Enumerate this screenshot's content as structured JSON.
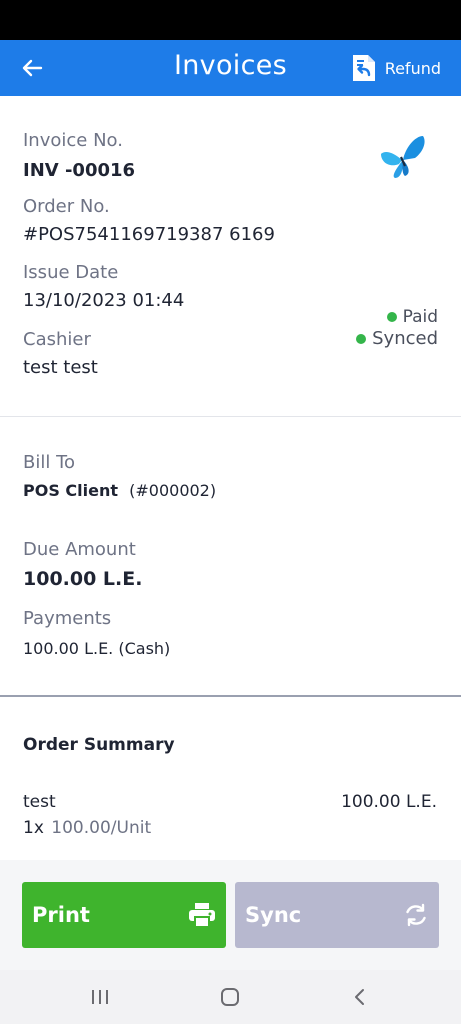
{
  "header": {
    "title": "Invoices",
    "refund_label": "Refund"
  },
  "invoice": {
    "invoice_no_label": "Invoice No.",
    "invoice_no": "INV -00016",
    "order_no_label": "Order No.",
    "order_no": "#POS7541169719387 6169",
    "issue_date_label": "Issue Date",
    "issue_date": "13/10/2023  01:44",
    "cashier_label": "Cashier",
    "cashier": "test test",
    "status_paid": "Paid",
    "status_synced": "Synced"
  },
  "billing": {
    "bill_to_label": "Bill To",
    "client_name": "POS Client",
    "client_id": "(#000002)",
    "due_amount_label": "Due Amount",
    "due_amount": "100.00 L.E.",
    "payments_label": "Payments",
    "payments_value": "100.00 L.E. (Cash)"
  },
  "summary": {
    "title": "Order Summary",
    "items": [
      {
        "name": "test",
        "qty": "1x",
        "unit_price": "100.00/Unit",
        "total": "100.00 L.E."
      }
    ]
  },
  "actions": {
    "print_label": "Print",
    "sync_label": "Sync"
  },
  "colors": {
    "appbar": "#1e7ce8",
    "print": "#3fb42d",
    "sync": "#b7b8cf",
    "status_dot": "#34b54a"
  },
  "icons": [
    "back-arrow-icon",
    "refund-icon",
    "butterfly-logo-icon",
    "printer-icon",
    "sync-icon",
    "recent-apps-icon",
    "home-icon",
    "nav-back-icon"
  ]
}
